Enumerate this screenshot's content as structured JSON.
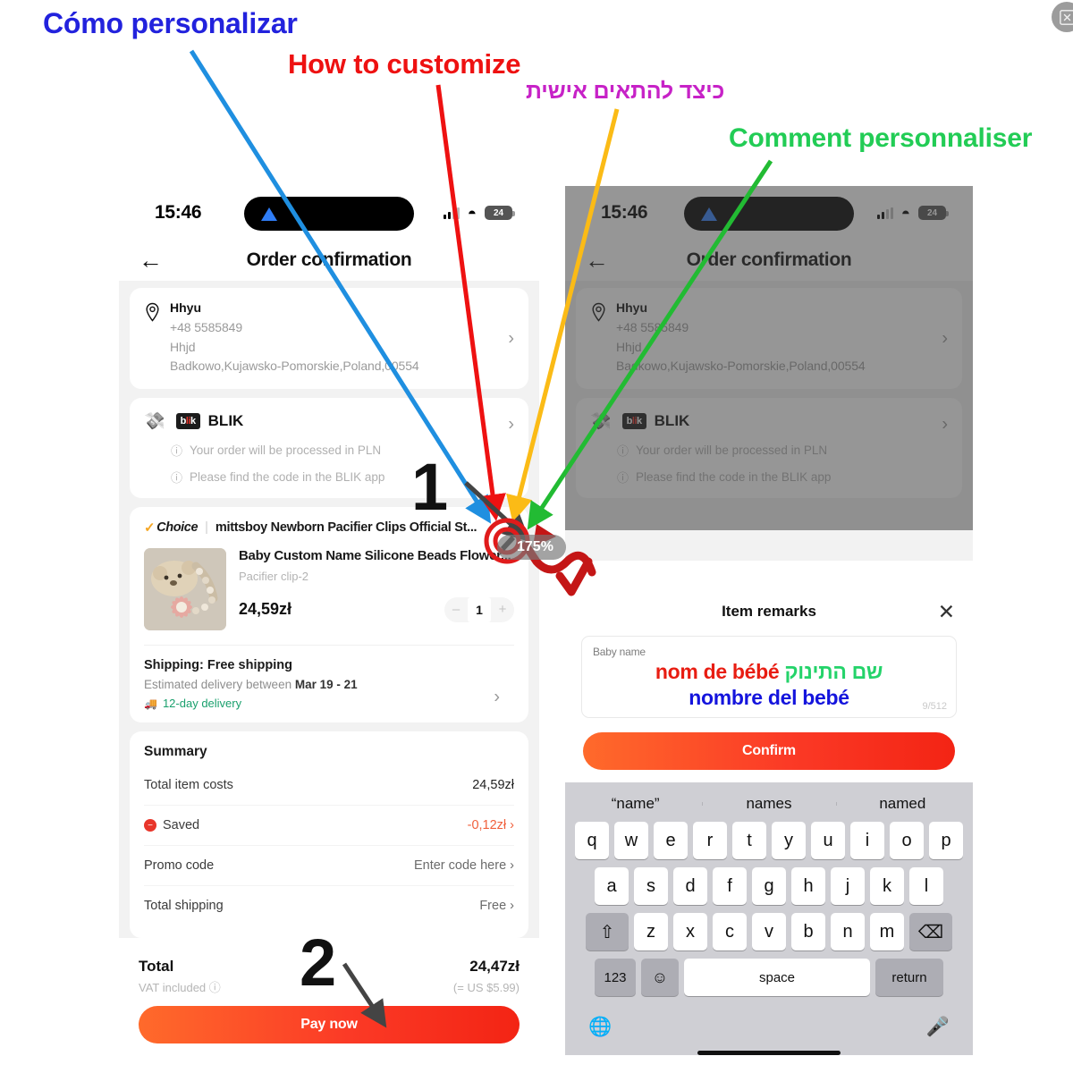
{
  "annotations": {
    "spanish": "Cómo personalizar",
    "english": "How to customize",
    "hebrew": "כיצד להתאים אישית",
    "french": "Comment personnaliser",
    "step1": "1",
    "step2": "2",
    "zoom_badge": "175%",
    "colors": {
      "spanish": "#2222dd",
      "english": "#ee1111",
      "hebrew": "#c722c7",
      "french": "#22cc55"
    }
  },
  "topbar": {
    "fullscreen_icon": "expand-icon"
  },
  "phone": {
    "status": {
      "time": "15:46",
      "battery": "24",
      "wifi_icon": "wifi-icon",
      "signal_icon": "signal-icon",
      "location_icon": "location-arrow-icon"
    },
    "nav": {
      "back_icon": "back-arrow-icon",
      "title": "Order confirmation"
    },
    "address": {
      "pin_icon": "map-pin-icon",
      "name": "Hhyu",
      "phone": "+48 5585849",
      "line2": "Hhjd",
      "line3": "Badkowo,Kujawsko-Pomorskie,Poland,00554",
      "chevron": "›"
    },
    "payment": {
      "wallet_icon": "payment-hand-icon",
      "logo_prefix": "b",
      "logo_mid": "li",
      "logo_suffix": "k",
      "name": "BLIK",
      "chevron": "›",
      "note1": "Your order will be processed in PLN",
      "note2": "Please find the code in the BLIK app",
      "info_icon": "info-circle-icon"
    },
    "store": {
      "choice_badge": "Choice",
      "choice_tick": "✓",
      "separator": "|",
      "name": "mittsboy Newborn Pacifier Clips Official St...",
      "edit_icon": "edit-pencil-icon"
    },
    "product": {
      "title": "Baby Custom Name Silicone Beads Flower...",
      "variant": "Pacifier clip-2",
      "price": "24,59zł",
      "qty_minus": "–",
      "qty_value": "1",
      "qty_plus": "+"
    },
    "shipping": {
      "title": "Shipping: Free shipping",
      "estimate_prefix": "Estimated delivery between ",
      "estimate_dates": "Mar 19 - 21",
      "fast_label": "12-day delivery",
      "truck_icon": "truck-icon",
      "chevron": "›"
    },
    "summary": {
      "title": "Summary",
      "rows": [
        {
          "label": "Total item costs",
          "value": "24,59zł",
          "style": "plain"
        },
        {
          "label": "Saved",
          "value": "-0,12zł ›",
          "style": "red",
          "icon": "saved-discount-icon"
        },
        {
          "label": "Promo code",
          "value": "Enter code here ›",
          "style": "muted"
        },
        {
          "label": "Total shipping",
          "value": "Free ›",
          "style": "muted"
        }
      ]
    },
    "total": {
      "label": "Total",
      "amount": "24,47zł",
      "vat_label": "VAT included",
      "vat_icon": "info-circle-icon",
      "usd": "(= US $5.99)",
      "pay_button": "Pay now"
    }
  },
  "modal": {
    "title": "Item remarks",
    "close_icon": "close-icon",
    "field_label": "Baby name",
    "value_red": "nom de bébé",
    "value_green": "שם התינוק",
    "value_blue": "nombre del bebé",
    "counter": "9/512",
    "confirm_button": "Confirm"
  },
  "keyboard": {
    "predictions": [
      "“name”",
      "names",
      "named"
    ],
    "row1": [
      "q",
      "w",
      "e",
      "r",
      "t",
      "y",
      "u",
      "i",
      "o",
      "p"
    ],
    "row2": [
      "a",
      "s",
      "d",
      "f",
      "g",
      "h",
      "j",
      "k",
      "l"
    ],
    "row3": [
      "z",
      "x",
      "c",
      "v",
      "b",
      "n",
      "m"
    ],
    "shift_icon": "shift-arrow-icon",
    "backspace_icon": "backspace-icon",
    "numbers_key": "123",
    "emoji_icon": "emoji-smiley-icon",
    "space_key": "space",
    "return_key": "return",
    "globe_icon": "globe-icon",
    "mic_icon": "microphone-icon"
  }
}
